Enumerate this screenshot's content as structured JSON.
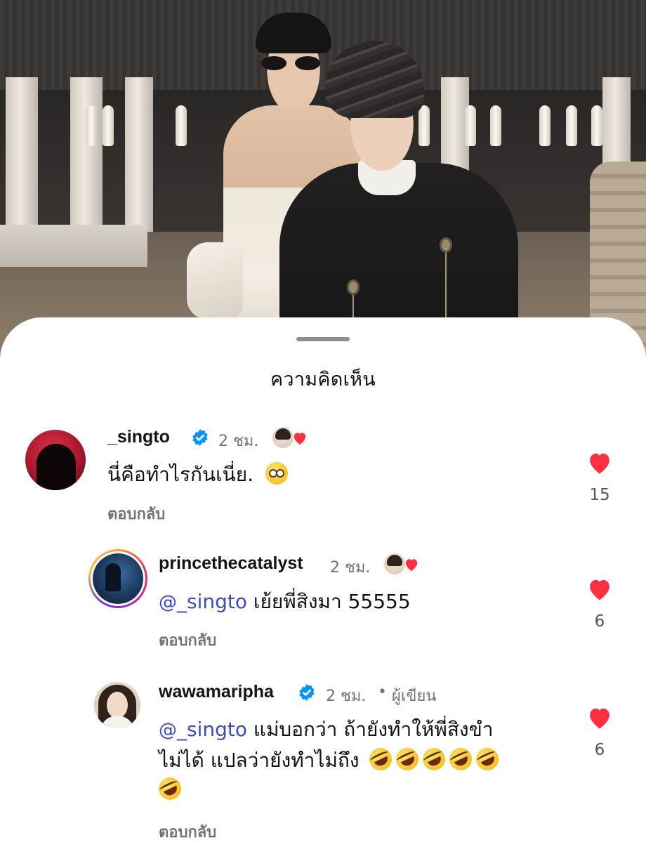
{
  "sheet": {
    "title": "ความคิดเห็น"
  },
  "comments": [
    {
      "username": "_singto",
      "verified": true,
      "time": "2 ชม.",
      "text": "นี่คือทำไรกันเนี่ย.",
      "emoji": "flushed-face",
      "reply_label": "ตอบกลับ",
      "likes": "15",
      "liked_by_creator": true
    },
    {
      "username": "princethecatalyst",
      "verified": false,
      "time": "2 ชม.",
      "mention": "_singto",
      "text": "เย้ยพี่สิงมา 55555",
      "reply_label": "ตอบกลับ",
      "likes": "6",
      "liked_by_creator": true
    },
    {
      "username": "wawamaripha",
      "verified": true,
      "time": "2 ชม.",
      "author_tag": "ผู้เขียน",
      "mention": "_singto",
      "text_line1": "แม่บอกว่า ถ้ายังทำให้พี่สิงขำ",
      "text_line2": "ไม่ได้ แปลว่ายังทำไม่ถึง",
      "emoji": "rolling-on-floor-laughing",
      "reply_label": "ตอบกลับ",
      "likes": "6"
    }
  ],
  "colors": {
    "heart": "#ff3040",
    "mention": "#3b4cc0",
    "verified": "#0095f6",
    "meta": "#737373"
  }
}
